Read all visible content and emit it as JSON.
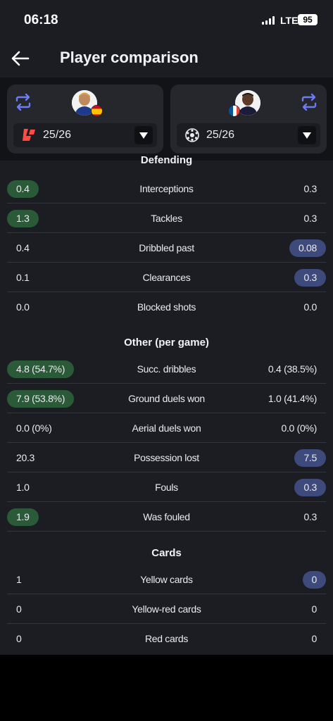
{
  "status_bar": {
    "time": "06:18",
    "network": "LTE",
    "battery": "95"
  },
  "header": {
    "title": "Player comparison"
  },
  "players": {
    "left": {
      "season": "25/26",
      "competition_icon": "laliga-logo-icon",
      "flag": "spain-flag"
    },
    "right": {
      "season": "25/26",
      "competition_icon": "champions-league-logo-icon",
      "flag": "france-flag"
    }
  },
  "colors": {
    "left_highlight": "#2a5a37",
    "right_highlight": "#3f4a7c",
    "accent": "#6e7bf2",
    "background": "#1b1d22"
  },
  "defending": {
    "title": "Defending",
    "rows": [
      {
        "label": "Interceptions",
        "left": "0.4",
        "right": "0.3",
        "winner": "left"
      },
      {
        "label": "Tackles",
        "left": "1.3",
        "right": "0.3",
        "winner": "left"
      },
      {
        "label": "Dribbled past",
        "left": "0.4",
        "right": "0.08",
        "winner": "right"
      },
      {
        "label": "Clearances",
        "left": "0.1",
        "right": "0.3",
        "winner": "right"
      },
      {
        "label": "Blocked shots",
        "left": "0.0",
        "right": "0.0",
        "winner": "none"
      }
    ]
  },
  "other": {
    "title": "Other (per game)",
    "rows": [
      {
        "label": "Succ. dribbles",
        "left": "4.8 (54.7%)",
        "right": "0.4 (38.5%)",
        "winner": "left"
      },
      {
        "label": "Ground duels won",
        "left": "7.9 (53.8%)",
        "right": "1.0 (41.4%)",
        "winner": "left"
      },
      {
        "label": "Aerial duels won",
        "left": "0.0 (0%)",
        "right": "0.0 (0%)",
        "winner": "none"
      },
      {
        "label": "Possession lost",
        "left": "20.3",
        "right": "7.5",
        "winner": "right"
      },
      {
        "label": "Fouls",
        "left": "1.0",
        "right": "0.3",
        "winner": "right"
      },
      {
        "label": "Was fouled",
        "left": "1.9",
        "right": "0.3",
        "winner": "left"
      }
    ]
  },
  "cards": {
    "title": "Cards",
    "rows": [
      {
        "label": "Yellow cards",
        "left": "1",
        "right": "0",
        "winner": "right"
      },
      {
        "label": "Yellow-red cards",
        "left": "0",
        "right": "0",
        "winner": "none"
      },
      {
        "label": "Red cards",
        "left": "0",
        "right": "0",
        "winner": "none"
      }
    ]
  }
}
